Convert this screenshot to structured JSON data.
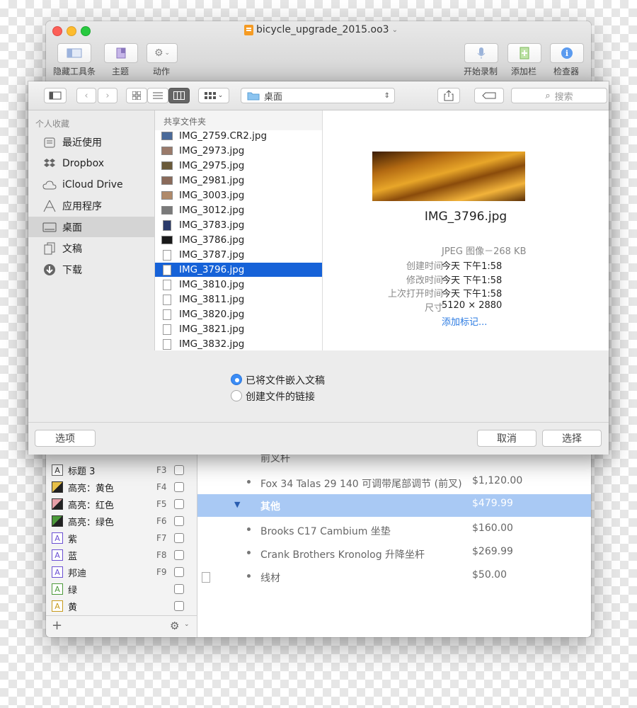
{
  "window": {
    "title": "bicycle_upgrade_2015.oo3",
    "toolbar": {
      "hide_toolbar": "隐藏工具条",
      "theme": "主题",
      "action": "动作",
      "start_recording": "开始录制",
      "add_column": "添加栏",
      "inspector": "检查器"
    }
  },
  "styles_panel": {
    "rows": [
      {
        "label": "标题 3",
        "shortcut": "F3",
        "icon": "A"
      },
      {
        "label": "高亮：黄色",
        "shortcut": "F4",
        "color": "#e8c14a"
      },
      {
        "label": "高亮：红色",
        "shortcut": "F5",
        "color": "#e7a0a8"
      },
      {
        "label": "高亮：绿色",
        "shortcut": "F6",
        "color": "#4c9a3a"
      },
      {
        "label": "紫",
        "shortcut": "F7",
        "icon": "A"
      },
      {
        "label": "蓝",
        "shortcut": "F8",
        "icon": "A"
      },
      {
        "label": "邦迪",
        "shortcut": "F9",
        "icon": "A"
      },
      {
        "label": "绿",
        "shortcut": "",
        "icon": "A"
      },
      {
        "label": "黄",
        "shortcut": "",
        "icon": "A"
      }
    ],
    "add": "+"
  },
  "outline": {
    "rows": [
      {
        "text": "前叉杆",
        "value": "",
        "bullet": false,
        "selected": false
      },
      {
        "text": "Fox 34 Talas 29 140 可调带尾部调节 (前叉)",
        "value": "$1,120.00",
        "bullet": true,
        "selected": false
      },
      {
        "text": "其他",
        "value": "$479.99",
        "bullet": false,
        "selected": true
      },
      {
        "text": "Brooks C17 Cambium 坐垫",
        "value": "$160.00",
        "bullet": true,
        "selected": false
      },
      {
        "text": "Crank Brothers Kronolog 升降坐杆",
        "value": "$269.99",
        "bullet": true,
        "selected": false
      },
      {
        "text": "线材",
        "value": "$50.00",
        "bullet": true,
        "selected": false
      }
    ]
  },
  "dialog": {
    "location": "桌面",
    "search_placeholder": "搜索",
    "favorites_header": "个人收藏",
    "favorites": [
      {
        "label": "最近使用",
        "icon": "recents-icon"
      },
      {
        "label": "Dropbox",
        "icon": "dropbox-icon"
      },
      {
        "label": "iCloud Drive",
        "icon": "cloud-icon"
      },
      {
        "label": "应用程序",
        "icon": "applications-icon"
      },
      {
        "label": "桌面",
        "icon": "desktop-icon",
        "selected": true
      },
      {
        "label": "文稿",
        "icon": "documents-icon"
      },
      {
        "label": "下载",
        "icon": "downloads-icon"
      }
    ],
    "files_header": "共享文件夹",
    "files": [
      {
        "name": "IMG_2759.CR2.jpg",
        "kind": "photo",
        "tint": "#4a6a9a"
      },
      {
        "name": "IMG_2973.jpg",
        "kind": "photo",
        "tint": "#9a7a6a"
      },
      {
        "name": "IMG_2975.jpg",
        "kind": "photo",
        "tint": "#6a5a3a"
      },
      {
        "name": "IMG_2981.jpg",
        "kind": "photo",
        "tint": "#8a6a5a"
      },
      {
        "name": "IMG_3003.jpg",
        "kind": "photo",
        "tint": "#b08a6a"
      },
      {
        "name": "IMG_3012.jpg",
        "kind": "photo",
        "tint": "#7a7a7a"
      },
      {
        "name": "IMG_3783.jpg",
        "kind": "photo",
        "tint": "#2a3a6a"
      },
      {
        "name": "IMG_3786.jpg",
        "kind": "photo",
        "tint": "#1a1a1a"
      },
      {
        "name": "IMG_3787.jpg",
        "kind": "doc"
      },
      {
        "name": "IMG_3796.jpg",
        "kind": "doc",
        "selected": true
      },
      {
        "name": "IMG_3810.jpg",
        "kind": "doc"
      },
      {
        "name": "IMG_3811.jpg",
        "kind": "doc"
      },
      {
        "name": "IMG_3820.jpg",
        "kind": "doc"
      },
      {
        "name": "IMG_3821.jpg",
        "kind": "doc"
      },
      {
        "name": "IMG_3832.jpg",
        "kind": "doc"
      }
    ],
    "preview": {
      "name": "IMG_3796.jpg",
      "kind_size": "JPEG 图像－268 KB",
      "meta": [
        {
          "label": "创建时间",
          "value": "今天 下午1:58"
        },
        {
          "label": "修改时间",
          "value": "今天 下午1:58"
        },
        {
          "label": "上次打开时间",
          "value": "今天 下午1:58"
        },
        {
          "label": "尺寸",
          "value": "5120 × 2880"
        }
      ],
      "add_tags": "添加标记..."
    },
    "options": {
      "embed": "已将文件嵌入文稿",
      "link": "创建文件的链接",
      "selected": "embed"
    },
    "buttons": {
      "options": "选项",
      "cancel": "取消",
      "choose": "选择"
    }
  }
}
